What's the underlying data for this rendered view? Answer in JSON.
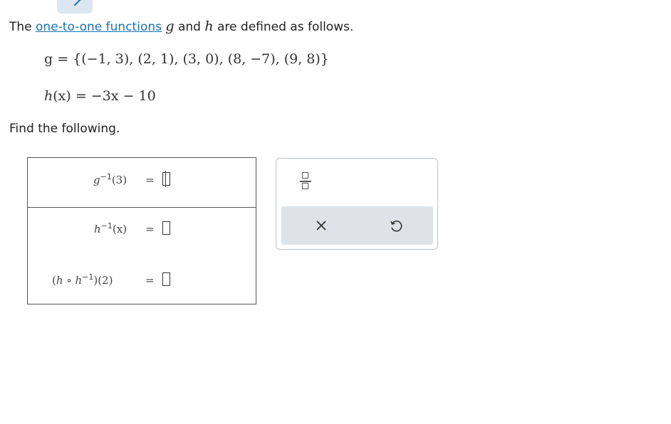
{
  "intro": {
    "prefix": "The ",
    "link": "one-to-one functions",
    "var_g": "g",
    "and": " and ",
    "var_h": "h",
    "suffix": " are defined as follows."
  },
  "definitions": {
    "g_def": "g = {(−1, 3), (2, 1), (3, 0), (8, −7), (9, 8)}",
    "h_def_lhs": "h",
    "h_def_arg": "(x)",
    "h_def_rhs": " = −3x − 10"
  },
  "prompt": "Find the following.",
  "answers": {
    "row1": {
      "fn": "g",
      "exp": "−1",
      "arg": "(3)",
      "equals": "=",
      "value": ""
    },
    "row2": {
      "fn": "h",
      "exp": "−1",
      "arg": "(x)",
      "equals": "=",
      "value": ""
    },
    "row3": {
      "open": "(",
      "fn1": "h",
      "compose": "∘",
      "fn2": "h",
      "exp": "−1",
      "close": ")",
      "arg": "(2)",
      "equals": "=",
      "value": ""
    }
  },
  "toolbar": {
    "fraction_icon": "fraction-icon",
    "clear_icon": "close-icon",
    "undo_icon": "undo-icon",
    "clear_glyph": "×"
  },
  "colors": {
    "link": "#1a73b5",
    "panel_bar": "#dde3e8",
    "tab": "#dbe6f0"
  }
}
